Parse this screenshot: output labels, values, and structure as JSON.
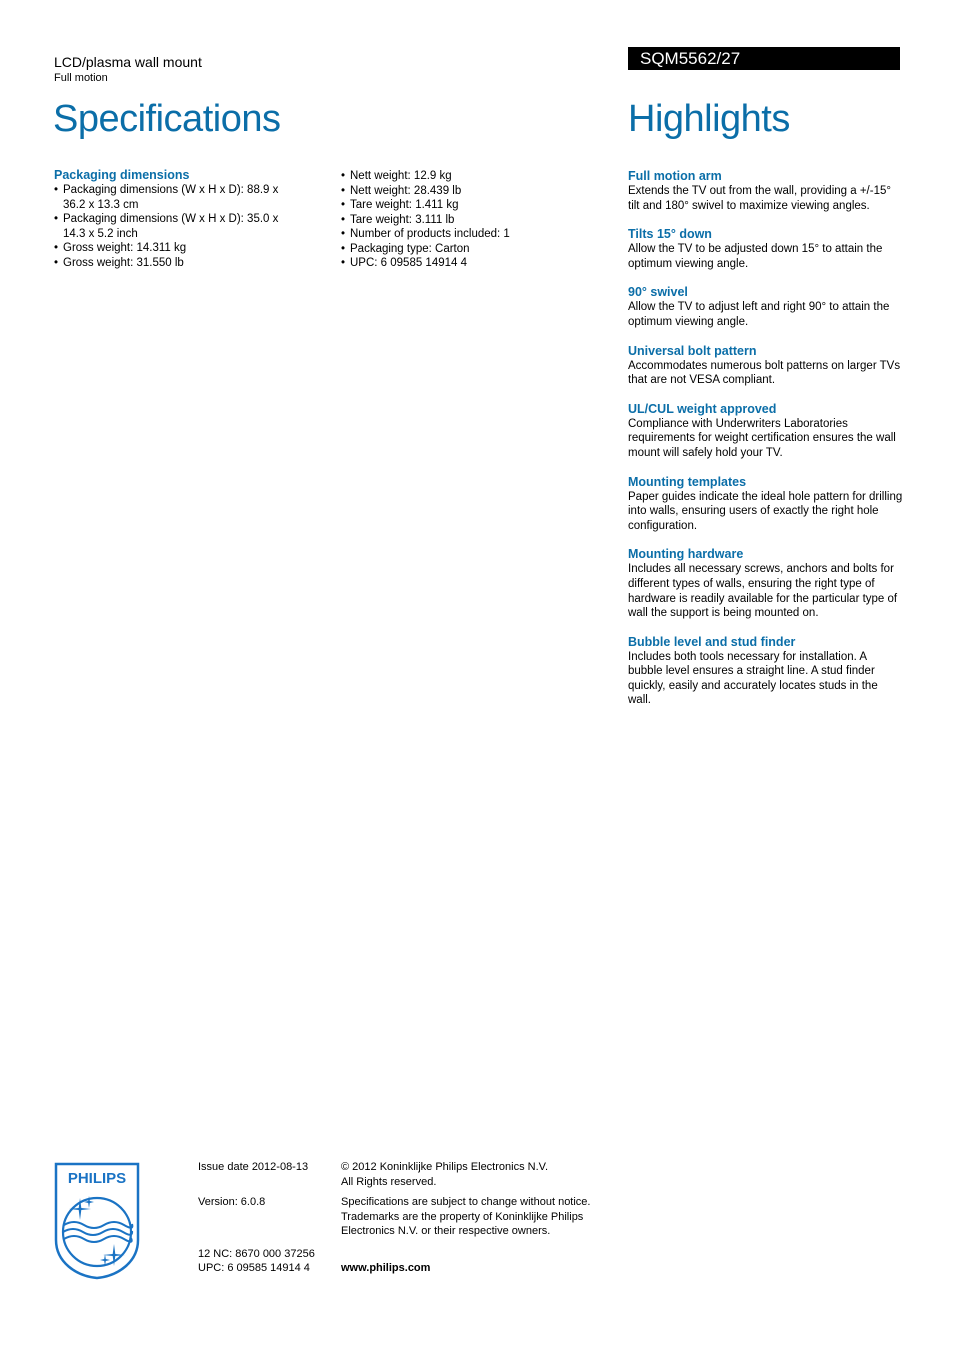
{
  "header": {
    "product_name": "LCD/plasma wall mount",
    "product_subtitle": "Full motion",
    "model": "SQM5562/27",
    "specs_title": "Specifications",
    "highlights_title": "Highlights"
  },
  "specifications": {
    "column1": {
      "group_title": "Packaging dimensions",
      "items": [
        "Packaging dimensions (W x H x D): 88.9 x 36.2 x 13.3 cm",
        "Packaging dimensions (W x H x D): 35.0 x 14.3 x 5.2 inch",
        "Gross weight: 14.311 kg",
        "Gross weight: 31.550 lb"
      ]
    },
    "column2": {
      "items": [
        "Nett weight: 12.9 kg",
        "Nett weight: 28.439 lb",
        "Tare weight: 1.411 kg",
        "Tare weight: 3.111 lb",
        "Number of products included: 1",
        "Packaging type: Carton",
        "UPC: 6 09585 14914 4"
      ]
    }
  },
  "highlights": [
    {
      "title": "Full motion arm",
      "text": "Extends the TV out from the wall, providing a +/-15° tilt and 180° swivel to maximize viewing angles."
    },
    {
      "title": "Tilts 15° down",
      "text": "Allow the TV to be adjusted down 15° to attain the optimum viewing angle."
    },
    {
      "title": "90° swivel",
      "text": "Allow the TV to adjust left and right 90° to attain the optimum viewing angle."
    },
    {
      "title": "Universal bolt pattern",
      "text": "Accommodates numerous bolt patterns on larger TVs that are not VESA compliant."
    },
    {
      "title": "UL/CUL weight approved",
      "text": "Compliance with Underwriters Laboratories requirements for weight certification ensures the wall mount will safely hold your TV."
    },
    {
      "title": "Mounting templates",
      "text": "Paper guides indicate the ideal hole pattern for drilling into walls, ensuring users of exactly the right hole configuration."
    },
    {
      "title": "Mounting hardware",
      "text": "Includes all necessary screws, anchors and bolts for different types of walls, ensuring the right type of hardware is readily available for the particular type of wall the support is being mounted on."
    },
    {
      "title": "Bubble level and stud finder",
      "text": "Includes both tools necessary for installation. A bubble level ensures a straight line. A stud finder quickly, easily and accurately locates studs in the wall."
    }
  ],
  "footer": {
    "logo_text": "PHILIPS",
    "issue_date": "Issue date 2012-08-13",
    "version": "Version: 6.0.8",
    "nc": "12 NC: 8670 000 37256",
    "upc": "UPC: 6 09585 14914 4",
    "copyright_line1": "© 2012 Koninklijke Philips Electronics N.V.",
    "copyright_line2": "All Rights reserved.",
    "disclaimer": "Specifications are subject to change without notice. Trademarks are the property of Koninklijke Philips Electronics N.V. or their respective owners.",
    "website": "www.philips.com"
  },
  "colors": {
    "accent": "#0b6ea8",
    "model_bar_bg": "#000000",
    "model_bar_text": "#ffffff"
  }
}
